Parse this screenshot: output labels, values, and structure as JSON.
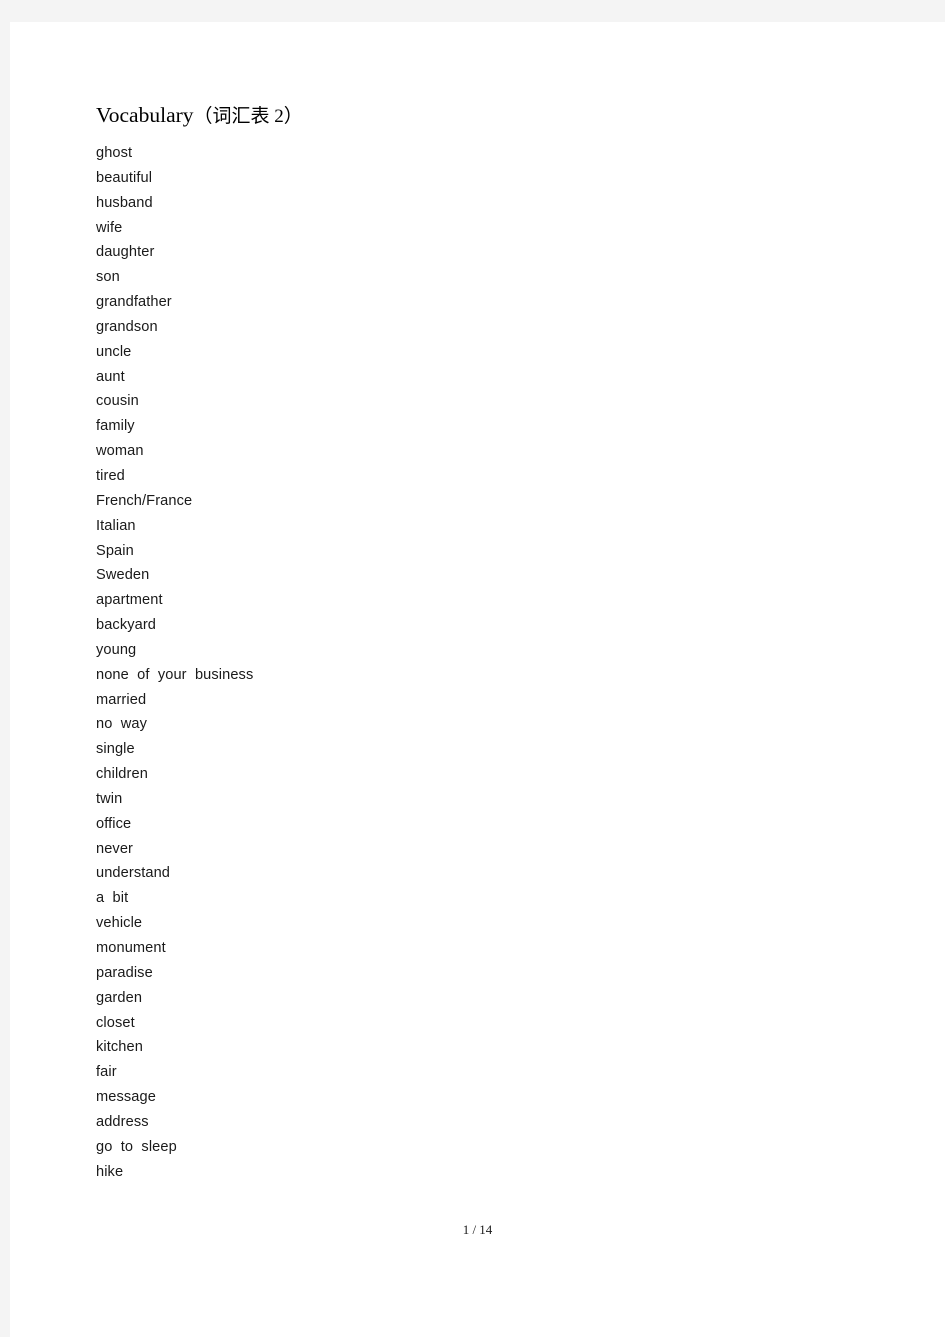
{
  "document": {
    "title_main": "Vocabulary",
    "title_cn": "（词汇表 2）",
    "page_indicator": "1 / 14",
    "background_color": "#f4f4f4",
    "page_color": "#ffffff",
    "text_color": "#1a1a1a"
  },
  "vocabulary": [
    "ghost",
    "beautiful",
    "husband",
    "wife",
    "daughter",
    "son",
    "grandfather",
    "grandson",
    "uncle",
    "aunt",
    "cousin",
    "family",
    "woman",
    "tired",
    "French/France",
    "Italian",
    "Spain",
    "Sweden",
    "apartment",
    "backyard",
    "young",
    "none  of  your  business",
    "married",
    "no  way",
    "single",
    "children",
    "twin",
    "office",
    "never",
    "understand",
    "a  bit",
    "vehicle",
    "monument",
    "paradise",
    "garden",
    "closet",
    "kitchen",
    "fair",
    "message",
    "address",
    "go  to  sleep",
    "hike"
  ]
}
